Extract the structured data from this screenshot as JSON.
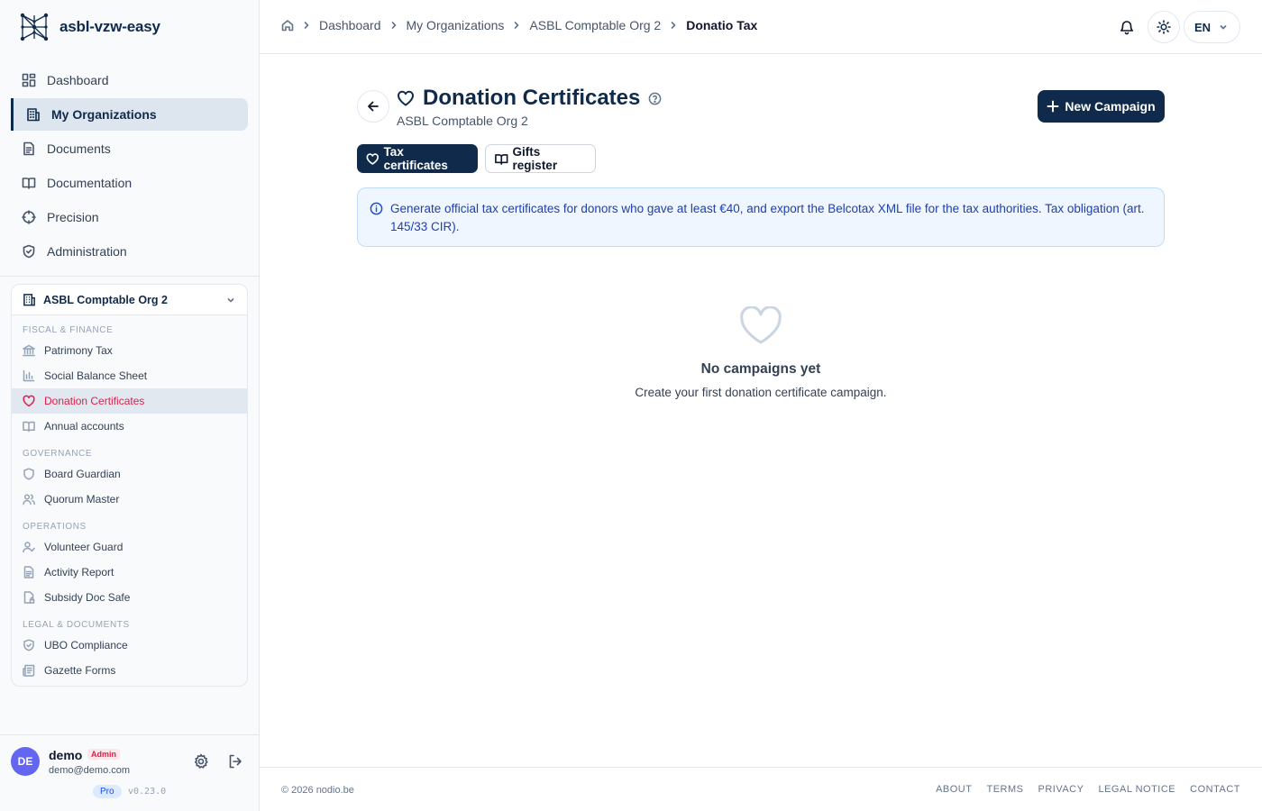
{
  "app": {
    "name": "asbl-vzw-easy"
  },
  "sidebar": {
    "items": [
      {
        "label": "Dashboard",
        "icon": "dashboard-icon"
      },
      {
        "label": "My Organizations",
        "icon": "building-icon",
        "active": true
      },
      {
        "label": "Documents",
        "icon": "document-icon"
      },
      {
        "label": "Documentation",
        "icon": "book-icon"
      },
      {
        "label": "Precision",
        "icon": "crosshair-icon"
      },
      {
        "label": "Administration",
        "icon": "shield-icon"
      }
    ],
    "org": {
      "name": "ASBL Comptable Org 2",
      "groups": [
        {
          "title": "FISCAL & FINANCE",
          "items": [
            "Patrimony Tax",
            "Social Balance Sheet",
            "Donation Certificates",
            "Annual accounts"
          ]
        },
        {
          "title": "GOVERNANCE",
          "items": [
            "Board Guardian",
            "Quorum Master"
          ]
        },
        {
          "title": "OPERATIONS",
          "items": [
            "Volunteer Guard",
            "Activity Report",
            "Subsidy Doc Safe"
          ]
        },
        {
          "title": "LEGAL & DOCUMENTS",
          "items": [
            "UBO Compliance",
            "Gazette Forms"
          ]
        }
      ],
      "active_item": "Donation Certificates"
    },
    "user": {
      "initials": "DE",
      "name": "demo",
      "role": "Admin",
      "email": "demo@demo.com",
      "plan": "Pro",
      "version": "v0.23.0"
    }
  },
  "topbar": {
    "breadcrumbs": [
      "Dashboard",
      "My Organizations",
      "ASBL Comptable Org 2",
      "Donatio Tax"
    ],
    "language": "EN"
  },
  "main": {
    "title": "Donation Certificates",
    "subtitle": "ASBL Comptable Org 2",
    "new_button": "New Campaign",
    "tabs": [
      {
        "label": "Tax certificates",
        "active": true
      },
      {
        "label": "Gifts register",
        "active": false
      }
    ],
    "info": "Generate official tax certificates for donors who gave at least €40, and export the Belcotax XML file for the tax authorities. Tax obligation (art. 145/33 CIR).",
    "empty": {
      "title": "No campaigns yet",
      "description": "Create your first donation certificate campaign."
    }
  },
  "footer": {
    "copyright": "© 2026 nodio.be",
    "links": [
      "About",
      "Terms",
      "Privacy",
      "Legal Notice",
      "Contact"
    ]
  },
  "colors": {
    "primary": "#0f2a4a",
    "accent": "#e11d48",
    "info_bg": "#eff6ff",
    "info_text": "#1e40af",
    "avatar": "#6366f1"
  }
}
